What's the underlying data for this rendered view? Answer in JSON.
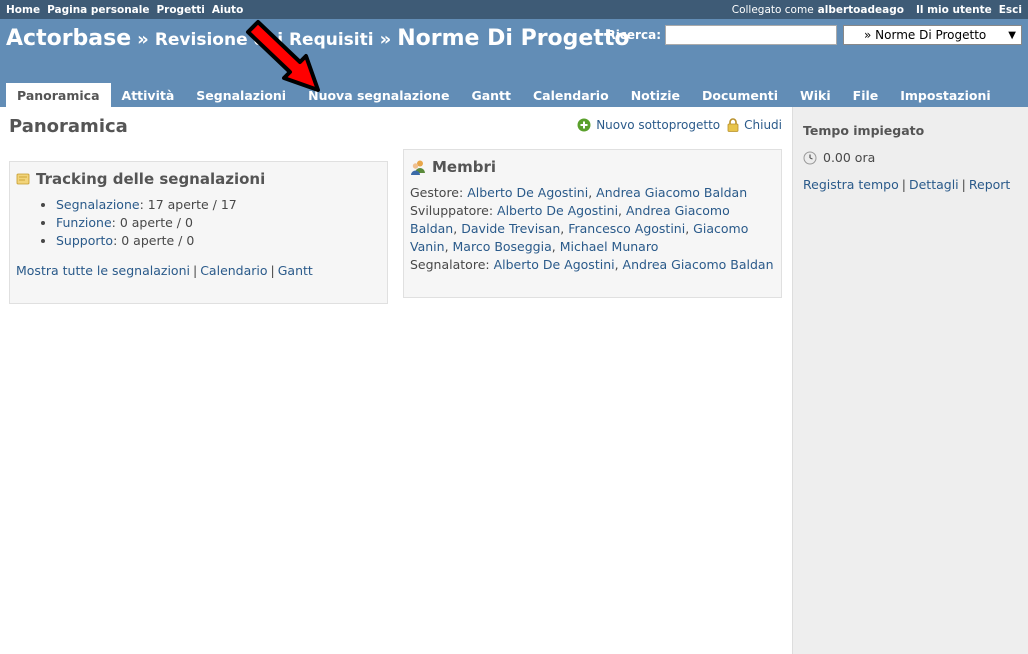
{
  "top_menu": {
    "items": [
      "Home",
      "Pagina personale",
      "Progetti",
      "Aiuto"
    ],
    "logged_as_label": "Collegato come",
    "username": "albertoadeago",
    "my_account": "Il mio utente",
    "logout": "Esci"
  },
  "header": {
    "project_root": "Actorbase",
    "separator": "»",
    "project_parent": "Revisione dei Requisiti",
    "project_current": "Norme Di Progetto",
    "search_label": "Ricerca:",
    "search_value": "",
    "jump_to": "» Norme Di Progetto"
  },
  "tabs": [
    {
      "label": "Panoramica",
      "selected": true
    },
    {
      "label": "Attività"
    },
    {
      "label": "Segnalazioni"
    },
    {
      "label": "Nuova segnalazione"
    },
    {
      "label": "Gantt"
    },
    {
      "label": "Calendario"
    },
    {
      "label": "Notizie"
    },
    {
      "label": "Documenti"
    },
    {
      "label": "Wiki"
    },
    {
      "label": "File"
    },
    {
      "label": "Impostazioni"
    }
  ],
  "page": {
    "title": "Panoramica",
    "new_subproject": "Nuovo sottoprogetto",
    "close": "Chiudi"
  },
  "issues_box": {
    "title": "Tracking delle segnalazioni",
    "trackers": [
      {
        "name": "Segnalazione",
        "stats": ": 17 aperte / 17"
      },
      {
        "name": "Funzione",
        "stats": ": 0 aperte / 0"
      },
      {
        "name": "Supporto",
        "stats": ": 0 aperte / 0"
      }
    ],
    "show_all": "Mostra tutte le segnalazioni",
    "calendar": "Calendario",
    "gantt": "Gantt",
    "divider": "|"
  },
  "members_box": {
    "title": "Membri",
    "roles": [
      {
        "role": "Gestore: ",
        "members": [
          "Alberto De Agostini",
          "Andrea Giacomo Baldan"
        ]
      },
      {
        "role": "Sviluppatore: ",
        "members": [
          "Alberto De Agostini",
          "Andrea Giacomo Baldan",
          "Davide Trevisan",
          "Francesco Agostini",
          "Giacomo Vanin",
          "Marco Boseggia",
          "Michael Munaro"
        ]
      },
      {
        "role": "Segnalatore: ",
        "members": [
          "Alberto De Agostini",
          "Andrea Giacomo Baldan"
        ]
      }
    ]
  },
  "sidebar": {
    "title": "Tempo impiegato",
    "time": "0.00 ora",
    "log_time": "Registra tempo",
    "details": "Dettagli",
    "report": "Report",
    "divider": "|"
  },
  "colors": {
    "top_menu": "#3e5b76",
    "header": "#628db6",
    "link": "#2a5a8a",
    "annotation_arrow": "#ff0000"
  }
}
